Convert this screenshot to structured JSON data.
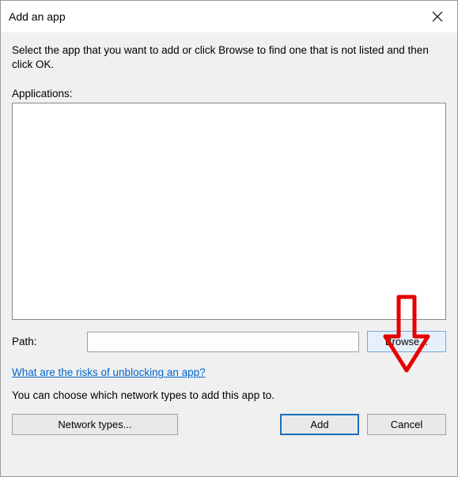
{
  "titlebar": {
    "title": "Add an app"
  },
  "instruction": "Select the app that you want to add or click Browse to find one that is not listed and then click OK.",
  "applications_label": "Applications:",
  "path": {
    "label": "Path:",
    "value": ""
  },
  "browse_label": "Browse...",
  "risks_link": "What are the risks of unblocking an app?",
  "network_note": "You can choose which network types to add this app to.",
  "buttons": {
    "network_types": "Network types...",
    "add": "Add",
    "cancel": "Cancel"
  },
  "annotation": {
    "color": "#e60000"
  }
}
